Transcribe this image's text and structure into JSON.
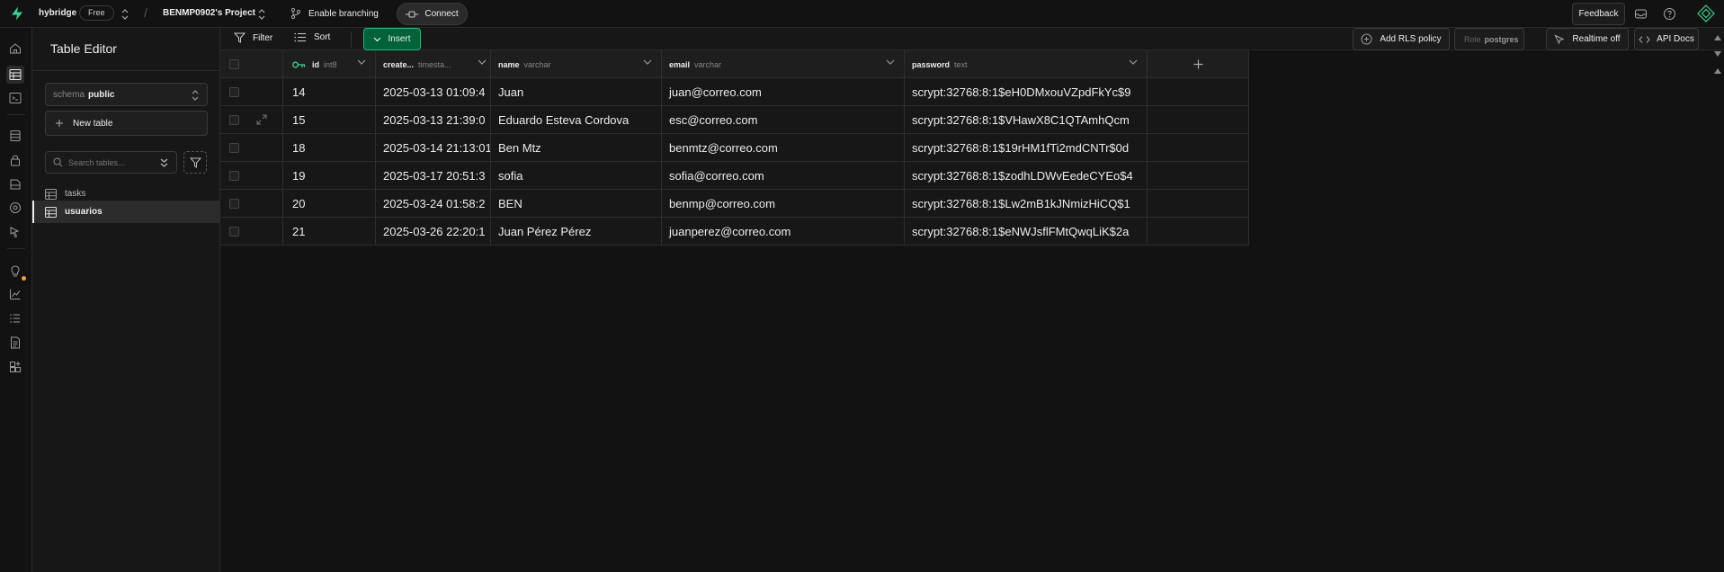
{
  "topbar": {
    "org_name": "hybridge",
    "plan_badge": "Free",
    "project_name": "BENMP0902's Project",
    "branching_label": "Enable branching",
    "connect_label": "Connect",
    "feedback_label": "Feedback"
  },
  "sidebar": {
    "title": "Table Editor",
    "schema_label": "schema",
    "schema_value": "public",
    "new_table_label": "New table",
    "search_placeholder": "Search tables...",
    "tables": [
      {
        "label": "tasks",
        "active": false
      },
      {
        "label": "usuarios",
        "active": true
      }
    ]
  },
  "toolbar": {
    "filter_label": "Filter",
    "sort_label": "Sort",
    "insert_label": "Insert",
    "rls_label": "Add RLS policy",
    "role_label": "Role",
    "role_value": "postgres",
    "realtime_label": "Realtime off",
    "api_docs_label": "API Docs"
  },
  "columns": [
    {
      "name": "id",
      "type": "int8",
      "key": true
    },
    {
      "name": "create...",
      "type": "timesta...",
      "key": false
    },
    {
      "name": "name",
      "type": "varchar",
      "key": false
    },
    {
      "name": "email",
      "type": "varchar",
      "key": false
    },
    {
      "name": "password",
      "type": "text",
      "key": false
    }
  ],
  "rows": [
    {
      "id": "14",
      "created": "2025-03-13 01:09:4",
      "name": "Juan",
      "email": "juan@correo.com",
      "password": "scrypt:32768:8:1$eH0DMxouVZpdFkYc$9"
    },
    {
      "id": "15",
      "created": "2025-03-13 21:39:0",
      "name": "Eduardo Esteva Cordova",
      "email": "esc@correo.com",
      "password": "scrypt:32768:8:1$VHawX8C1QTAmhQcm"
    },
    {
      "id": "18",
      "created": "2025-03-14 21:13:01",
      "name": "Ben Mtz",
      "email": "benmtz@correo.com",
      "password": "scrypt:32768:8:1$19rHM1fTi2mdCNTr$0d"
    },
    {
      "id": "19",
      "created": "2025-03-17 20:51:3",
      "name": "sofia",
      "email": "sofia@correo.com",
      "password": "scrypt:32768:8:1$zodhLDWvEedeCYEo$4"
    },
    {
      "id": "20",
      "created": "2025-03-24 01:58:2",
      "name": "BEN",
      "email": "benmp@correo.com",
      "password": "scrypt:32768:8:1$Lw2mB1kJNmizHiCQ$1"
    },
    {
      "id": "21",
      "created": "2025-03-26 22:20:1",
      "name": "Juan Pérez Pérez",
      "email": "juanperez@correo.com",
      "password": "scrypt:32768:8:1$eNWJsflFMtQwqLiK$2a"
    }
  ],
  "colors": {
    "accent_green": "#3ecf8e",
    "insert_bg": "#006239",
    "notification_dot": "#f29f36",
    "background": "#121212"
  },
  "icons": {
    "add_column": "plus-icon",
    "key": "key-icon"
  }
}
